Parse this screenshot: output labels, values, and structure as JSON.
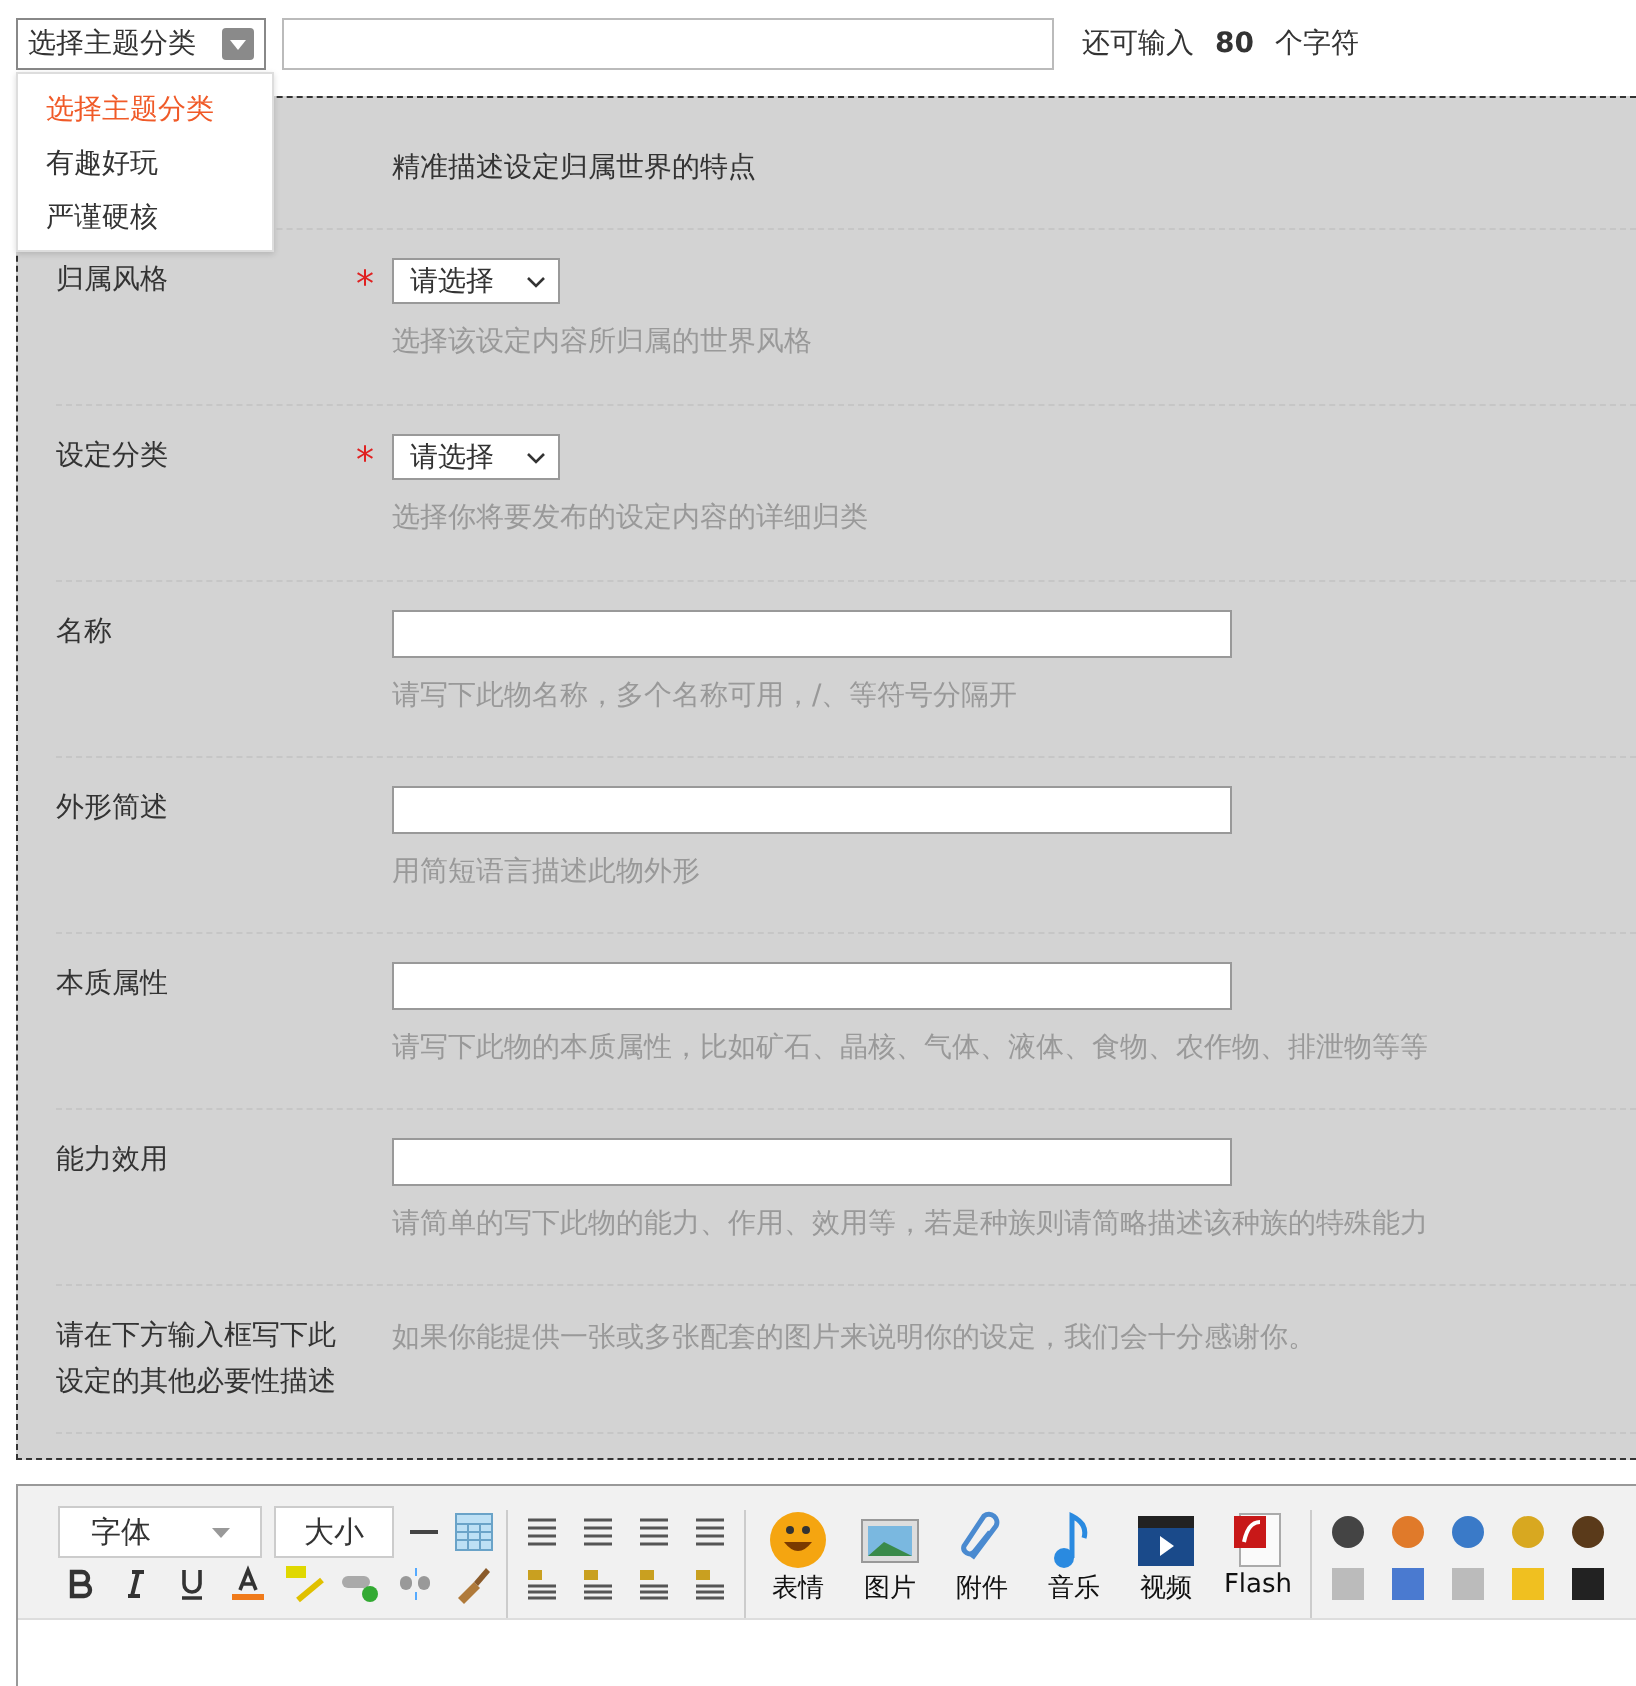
{
  "title_bar": {
    "category_select": {
      "value": "选择主题分类",
      "expanded": true
    },
    "char_counter": {
      "prefix": "还可输入",
      "count": "80",
      "suffix": "个字符"
    }
  },
  "category_menu": [
    {
      "label": "选择主题分类",
      "selected": true
    },
    {
      "label": "有趣好玩",
      "selected": false
    },
    {
      "label": "严谨硬核",
      "selected": false
    }
  ],
  "form": {
    "rows": [
      {
        "kind": "intro",
        "text": "精准描述设定归属世界的特点"
      },
      {
        "kind": "select",
        "label": "归属风格",
        "required_mark": "*",
        "value": "请选择",
        "hint": "选择该设定内容所归属的世界风格"
      },
      {
        "kind": "select",
        "label": "设定分类",
        "required_mark": "*",
        "value": "请选择",
        "hint": "选择你将要发布的设定内容的详细归类"
      },
      {
        "kind": "input",
        "label": "名称",
        "hint": "请写下此物名称，多个名称可用，/、等符号分隔开"
      },
      {
        "kind": "input",
        "label": "外形简述",
        "hint": "用简短语言描述此物外形"
      },
      {
        "kind": "input",
        "label": "本质属性",
        "hint": "请写下此物的本质属性，比如矿石、晶核、气体、液体、食物、农作物、排泄物等等"
      },
      {
        "kind": "input",
        "label": "能力效用",
        "hint": "请简单的写下此物的能力、作用、效用等，若是种族则请简略描述该种族的特殊能力"
      },
      {
        "kind": "note",
        "label": "请在下方输入框写下此设定的其他必要性描述",
        "hint": "如果你能提供一张或多张配套的图片来说明你的设定，我们会十分感谢你。"
      }
    ]
  },
  "editor": {
    "font_select": "字体",
    "size_select": "大小",
    "media_buttons": [
      "表情",
      "图片",
      "附件",
      "音乐",
      "视频",
      "Flash"
    ]
  }
}
